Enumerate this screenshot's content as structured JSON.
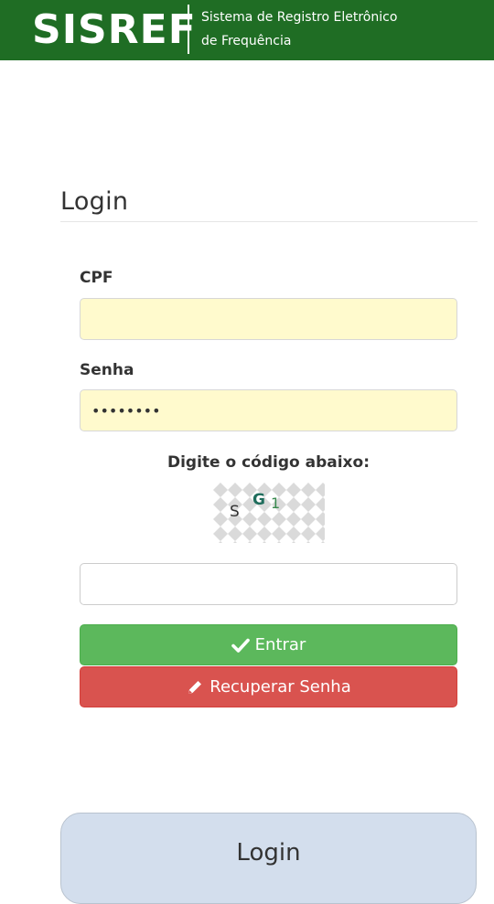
{
  "header": {
    "logo_text": "SISREF",
    "subtitle_line1": "Sistema de Registro Eletrônico",
    "subtitle_line2": "de Frequência",
    "background_color": "#1f6d24"
  },
  "login_panel": {
    "title": "Login",
    "cpf_label": "CPF",
    "cpf_value": "",
    "senha_label": "Senha",
    "senha_value": "••••••••",
    "captcha_label": "Digite o código abaixo:",
    "captcha_text": "SG1",
    "captcha_chars": [
      "S",
      "G",
      "1"
    ],
    "captcha_input_value": "",
    "enter_button_label": "Entrar",
    "enter_button_icon": "check-icon",
    "recover_button_label": "Recuperar Senha",
    "recover_button_icon": "pencil-icon"
  },
  "bottom_card": {
    "title": "Login"
  },
  "colors": {
    "success": "#5cb85c",
    "danger": "#d9534f",
    "autofill": "#fffacd",
    "card_bg": "#d3deed"
  }
}
